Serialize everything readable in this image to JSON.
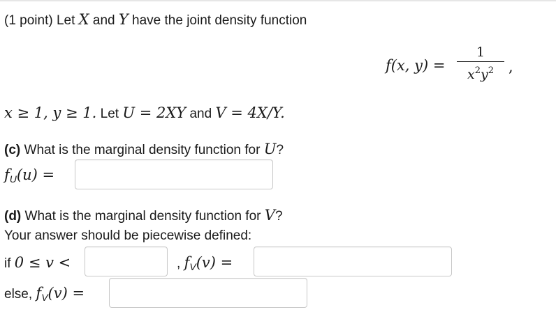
{
  "problem": {
    "intro_prefix": "(1 point) Let ",
    "var_x": "X",
    "and_word": " and ",
    "var_y": "Y",
    "intro_suffix": " have the joint density function",
    "density_lhs": "f(x, y) =",
    "density_numerator": "1",
    "density_denominator_x": "x",
    "density_denominator_y": "y",
    "density_exponent": "2",
    "density_trailing": ",",
    "support": "x ≥ 1, y ≥ 1.",
    "let_text": " Let ",
    "u_def": "U = 2XY",
    "and_text": " and ",
    "v_def": "V = 4X/Y."
  },
  "part_c": {
    "label": "(c)",
    "question": " What is the marginal density function for ",
    "var": "U",
    "question_end": "?",
    "lhs_f": "f",
    "lhs_sub": "U",
    "lhs_arg": "(u) =",
    "answer_value": ""
  },
  "part_d": {
    "label": "(d)",
    "question": " What is the marginal density function for ",
    "var": "V",
    "question_end": "?",
    "instruction": "Your answer should be piecewise defined:",
    "if_text": "if ",
    "condition": "0 ≤ v <",
    "bound_value": "",
    "comma": ",",
    "lhs_f": "f",
    "lhs_sub": "V",
    "lhs_arg": "(v) =",
    "piece_value": "",
    "else_text": "else, ",
    "else_value": ""
  }
}
